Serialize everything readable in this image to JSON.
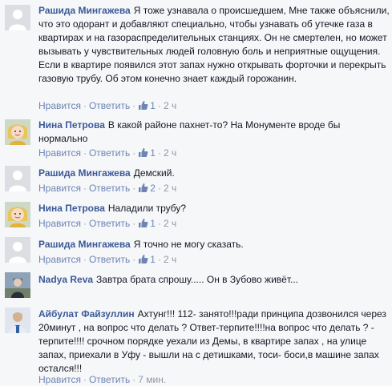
{
  "comments": [
    {
      "author": "Рашида Мингажева",
      "text": "Я тоже узнавала о происшедшем, Мне также объяснили, что это одорант и добавляют специально, чтобы узнавать об утечке газа в квартирах и на газораспределительных станциях. Он не смертелен, но может вызывать у чувствительных людей головную боль и неприятные ощущения. Если в квартире появился этот запах нужно открывать форточки и перекрыть газовую трубу. Об этом конечно знает каждый горожанин.",
      "like_label": "Нравится",
      "reply_label": "Ответить",
      "separator": "·",
      "likes": "1",
      "time": "2 ч"
    },
    {
      "author": "Нина Петрова",
      "text": "В какой районе пахнет-то? На Монументе вроде бы нормально",
      "like_label": "Нравится",
      "reply_label": "Ответить",
      "separator": "·",
      "likes": "1",
      "time": "2 ч"
    },
    {
      "author": "Рашида Мингажева",
      "text": "Демский.",
      "like_label": "Нравится",
      "reply_label": "Ответить",
      "separator": "·",
      "likes": "2",
      "time": "2 ч"
    },
    {
      "author": "Нина Петрова",
      "text": "Наладили трубу?",
      "like_label": "Нравится",
      "reply_label": "Ответить",
      "separator": "·",
      "likes": "1",
      "time": "2 ч"
    },
    {
      "author": "Рашида Мингажева",
      "text": "Я точно не могу сказать.",
      "like_label": "Нравится",
      "reply_label": "Ответить",
      "separator": "·",
      "likes": "1",
      "time": "2 ч"
    },
    {
      "author": "Nadya Reva",
      "text": "Завтра брата спрошу..... Он в Зубово живёт..."
    },
    {
      "author": "Айбулат Файзуллин",
      "text": "Ахтунг!!! 112- занято!!!ради принципа дозвонился через 20минут , на вопрос что делать ? Ответ-терпите!!!!на вопрос что делать ? - терпите!!!! срочном порядке уехали из Демы, в квартире запах , на улице запах, приехали в Уфу - вышли на с детишками, тоси- боси,в машине запах остался!!!",
      "like_label": "Нравится",
      "reply_label": "Ответить",
      "separator": "·",
      "time": "7 мин."
    }
  ],
  "colors": {
    "background": "#f6f7f9",
    "author": "#3b5998",
    "link": "#6d84b4",
    "meta": "#9197a3",
    "text": "#141823"
  },
  "icons": {
    "placeholder_avatar": "default-avatar-silhouette",
    "like": "thumbs-up-icon"
  }
}
